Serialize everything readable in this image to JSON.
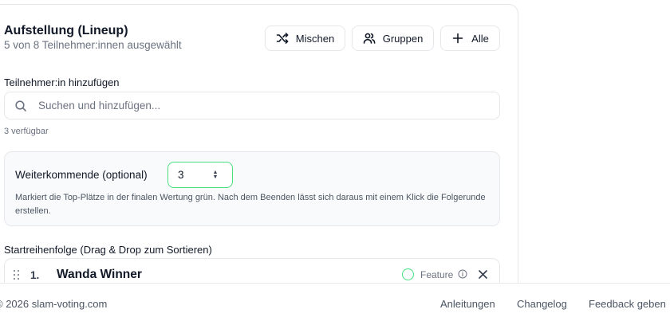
{
  "lineup": {
    "title": "Aufstellung (Lineup)",
    "subtitle": "5 von 8 Teilnehmer:innen ausgewählt",
    "buttons": {
      "shuffle": "Mischen",
      "groups": "Gruppen",
      "all": "Alle"
    }
  },
  "add_participant": {
    "label": "Teilnehmer:in hinzufügen",
    "placeholder": "Suchen und hinzufügen...",
    "available": "3 verfügbar"
  },
  "advancing": {
    "label": "Weiterkommende (optional)",
    "value": "3",
    "help": "Markiert die Top-Plätze in der finalen Wertung grün. Nach dem Beenden lässt sich daraus mit einem Klick die Folgerunde erstellen."
  },
  "start_order": {
    "label": "Startreihenfolge (Drag & Drop zum Sortieren)",
    "items": [
      {
        "rank": "1.",
        "name": "Wanda Winner",
        "feature_label": "Feature"
      }
    ]
  },
  "footer": {
    "copyright": "© 2026 slam-voting.com",
    "links": [
      "Anleitungen",
      "Changelog",
      "Feedback geben"
    ]
  },
  "colors": {
    "accent_green": "#4ade80",
    "border": "#e5e7eb",
    "muted_text": "#6b7280",
    "panel_bg": "#f9fafb"
  }
}
